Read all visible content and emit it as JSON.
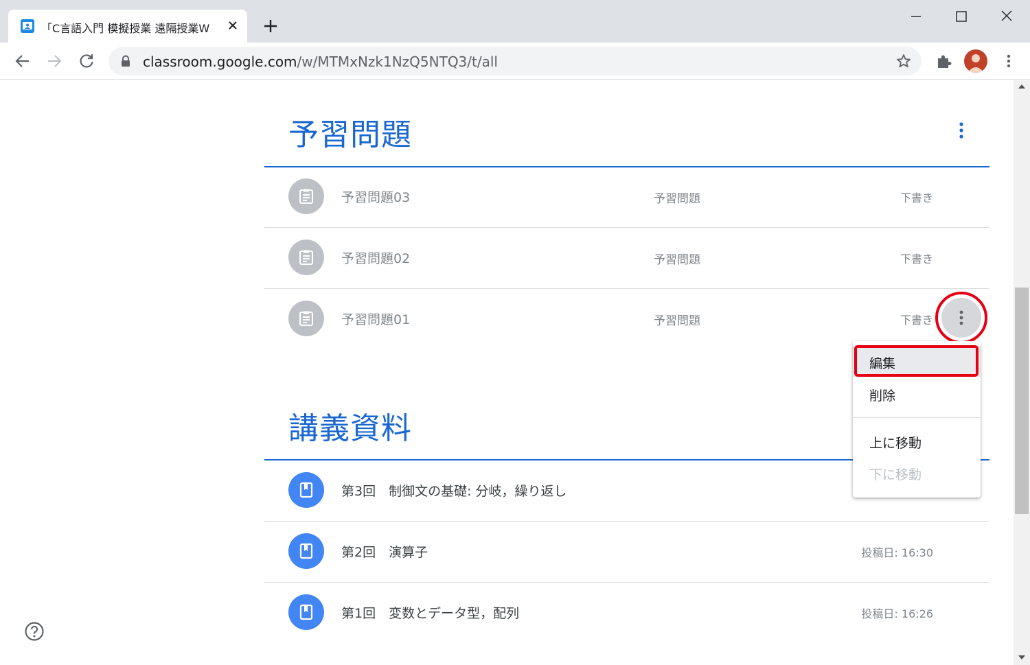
{
  "browser": {
    "tab_title": "「C言語入門 模擬授業 遠隔授業W",
    "url_host": "classroom.google.com",
    "url_path": "/w/MTMxNzk1NzQ5NTQ3/t/all"
  },
  "sections": {
    "yoshu": {
      "title": "予習問題",
      "items": [
        {
          "title": "予習問題03",
          "topic": "予習問題",
          "status": "下書き"
        },
        {
          "title": "予習問題02",
          "topic": "予習問題",
          "status": "下書き"
        },
        {
          "title": "予習問題01",
          "topic": "予習問題",
          "status": "下書き"
        }
      ]
    },
    "kougi": {
      "title": "講義資料",
      "items": [
        {
          "title": "第3回　制御文の基礎: 分岐，繰り返し",
          "status": ""
        },
        {
          "title": "第2回　演算子",
          "status": "投稿日: 16:30"
        },
        {
          "title": "第1回　変数とデータ型，配列",
          "status": "投稿日: 16:26"
        }
      ]
    }
  },
  "context_menu": {
    "edit": "編集",
    "delete": "削除",
    "move_up": "上に移動",
    "move_down": "下に移動"
  },
  "colors": {
    "accent": "#1967d2",
    "callout": "#e60012",
    "material_icon": "#4285f4",
    "draft_icon": "#bdc1c6"
  }
}
